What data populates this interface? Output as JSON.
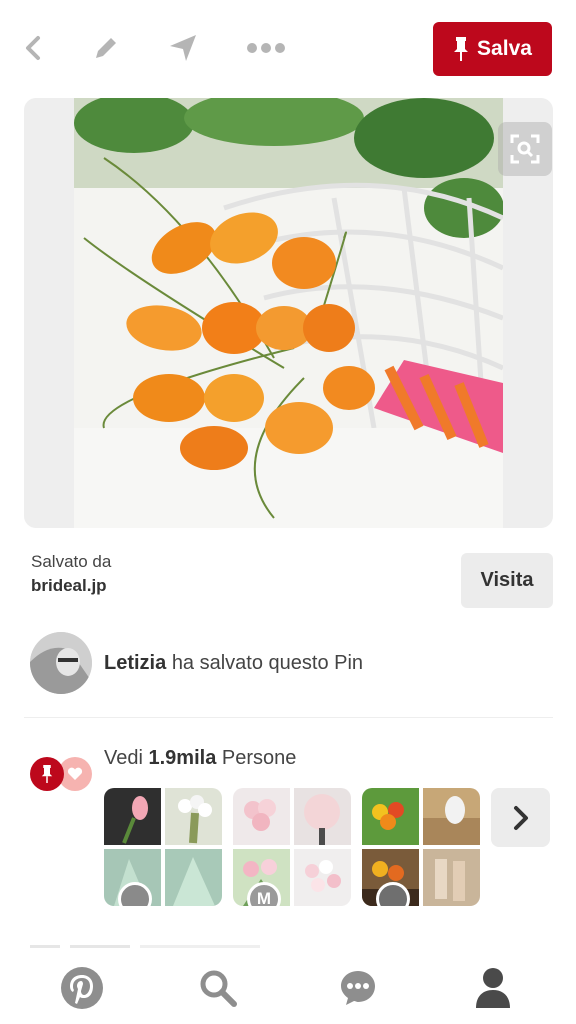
{
  "header": {
    "save_label": "Salva"
  },
  "source": {
    "label": "Salvato da",
    "site": "brideal.jp",
    "visit_label": "Visita"
  },
  "saver": {
    "name": "Letizia",
    "action": "ha salvato questo Pin"
  },
  "activity": {
    "prefix": "Vedi",
    "count": "1.9mila",
    "suffix": "Persone"
  },
  "boards": [
    {
      "avatar": "",
      "avatar_color": "#8a8a8a"
    },
    {
      "avatar": "M",
      "avatar_color": "#9a9a9a"
    },
    {
      "avatar": "",
      "avatar_color": "#6f6f6f"
    }
  ],
  "colors": {
    "brand_red": "#bd081c",
    "heart_pink": "#f6b3b0",
    "icon_gray": "#b5b5b5",
    "nav_gray": "#8e8e8e",
    "nav_active": "#4a4a4a"
  },
  "icons": [
    "back-icon",
    "edit-icon",
    "send-icon",
    "more-icon",
    "pin-icon",
    "visual-search-icon",
    "heart-icon",
    "chevron-right-icon",
    "pinterest-home-icon",
    "search-icon",
    "messages-icon",
    "profile-icon"
  ]
}
